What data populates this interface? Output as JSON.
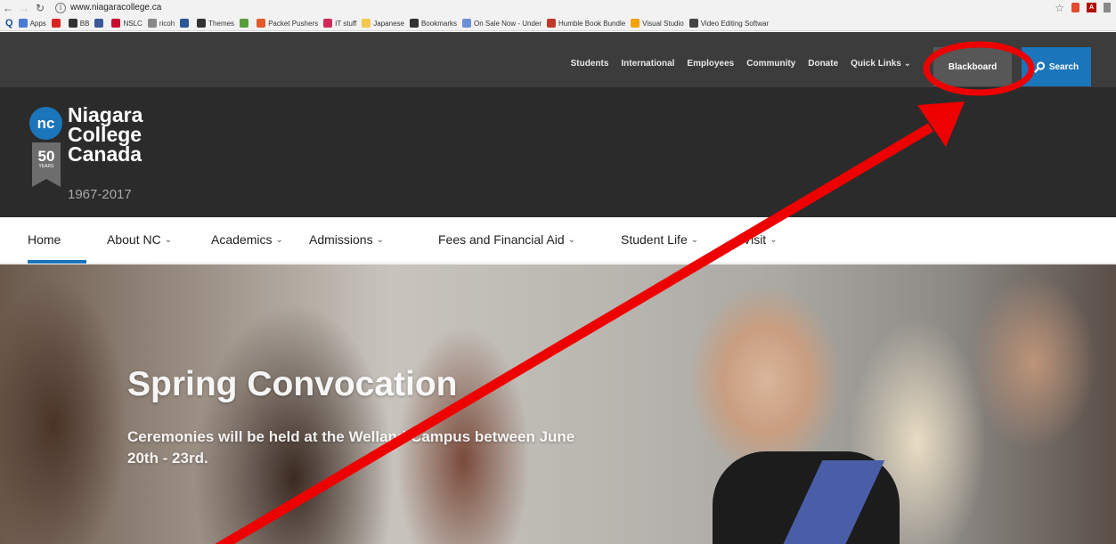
{
  "browser": {
    "url": "www.niagaracollege.ca",
    "bookmarks": [
      {
        "label": "Apps",
        "color": "#4a7bd1"
      },
      {
        "label": "",
        "color": "#d22"
      },
      {
        "label": "BB",
        "color": "#333"
      },
      {
        "label": "",
        "color": "#3b5998"
      },
      {
        "label": "NSLC",
        "color": "#c8102e"
      },
      {
        "label": "ricoh",
        "color": "#888"
      },
      {
        "label": "",
        "color": "#2b5797"
      },
      {
        "label": "Themes",
        "color": "#333"
      },
      {
        "label": "",
        "color": "#5a9e3c"
      },
      {
        "label": "Packet Pushers",
        "color": "#e25a2a"
      },
      {
        "label": "IT stuff",
        "color": "#d2285a"
      },
      {
        "label": "Japanese",
        "color": "#f2c94c"
      },
      {
        "label": "Bookmarks",
        "color": "#333"
      },
      {
        "label": "On Sale Now - Under",
        "color": "#6a8fd4"
      },
      {
        "label": "Humble Book Bundle",
        "color": "#c0392b"
      },
      {
        "label": "Visual Studio",
        "color": "#f0a30a"
      },
      {
        "label": "Video Editing Softwar",
        "color": "#444"
      }
    ]
  },
  "utility": {
    "links": [
      "Students",
      "International",
      "Employees",
      "Community",
      "Donate",
      "Quick Links"
    ],
    "blackboard": "Blackboard",
    "search": "Search"
  },
  "logo": {
    "badge": "nc",
    "line1": "Niagara",
    "line2": "College",
    "line3": "Canada",
    "fifty": "50",
    "fifty_sub": "YEARS",
    "years": "1967-2017"
  },
  "nav": {
    "items": [
      "Home",
      "About NC",
      "Academics",
      "Admissions",
      "Fees and Financial Aid",
      "Student Life",
      "Visit"
    ]
  },
  "hero": {
    "title": "Spring Convocation",
    "subtitle": "Ceremonies will be held at the Welland Campus between June 20th - 23rd."
  },
  "colors": {
    "accent": "#1b75bb",
    "annotation": "#ee0000"
  }
}
